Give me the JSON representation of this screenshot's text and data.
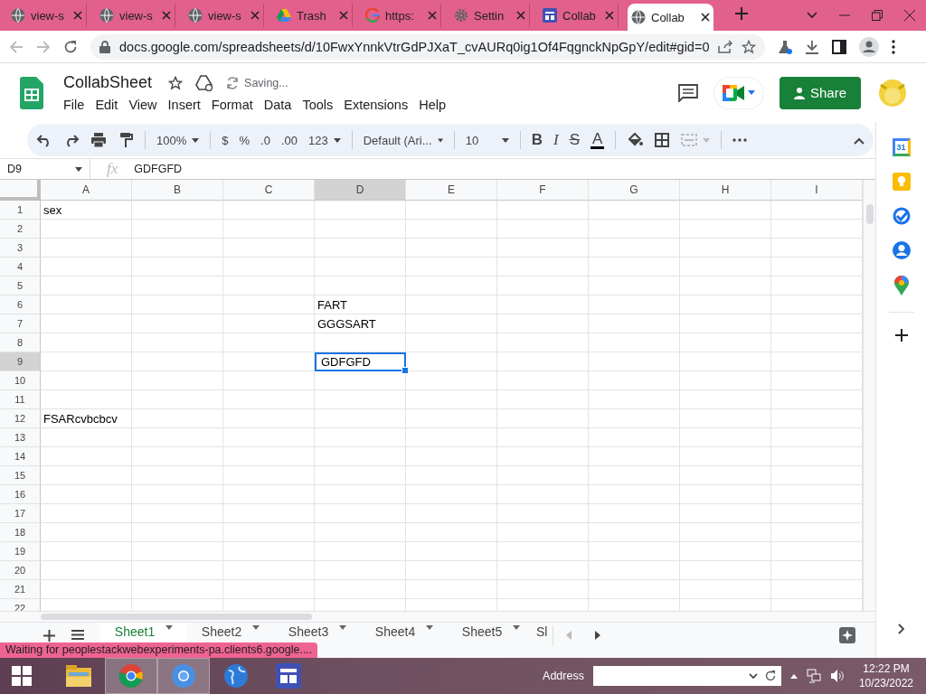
{
  "browser": {
    "tabs": [
      {
        "title": "view-s",
        "kind": "globe",
        "selected": false
      },
      {
        "title": "view-s",
        "kind": "globe",
        "selected": false
      },
      {
        "title": "view-s",
        "kind": "globe",
        "selected": false
      },
      {
        "title": "Trash",
        "kind": "drive",
        "selected": false
      },
      {
        "title": "https:",
        "kind": "google",
        "selected": false
      },
      {
        "title": "Settin",
        "kind": "gear",
        "selected": false
      },
      {
        "title": "Collab",
        "kind": "sheets",
        "selected": false
      },
      {
        "title": "Collab",
        "kind": "globe",
        "selected": true
      }
    ],
    "url": "docs.google.com/spreadsheets/d/10FwxYnnkVtrGdPJXaT_cvAURq0ig1Of4FqgnckNpGpY/edit#gid=0"
  },
  "app": {
    "title": "CollabSheet",
    "status": "Saving...",
    "menus": [
      "File",
      "Edit",
      "View",
      "Insert",
      "Format",
      "Data",
      "Tools",
      "Extensions",
      "Help"
    ],
    "share": "Share"
  },
  "toolbar": {
    "zoom": "100%",
    "currency": "$",
    "percent": "%",
    "decrease_decimals": ".0",
    "increase_decimals": ".00",
    "number_format": "123",
    "font": "Default (Ari...",
    "font_size": "10",
    "bold": "B",
    "italic": "I",
    "strikethrough": "S",
    "text_color": "A"
  },
  "formula_bar": {
    "cell_ref": "D9",
    "function_label": "fx",
    "value": "GDFGFD"
  },
  "grid": {
    "columns": [
      {
        "label": "A",
        "selected": false
      },
      {
        "label": "B",
        "selected": false
      },
      {
        "label": "C",
        "selected": false
      },
      {
        "label": "D",
        "selected": true
      },
      {
        "label": "E",
        "selected": false
      },
      {
        "label": "F",
        "selected": false
      },
      {
        "label": "G",
        "selected": false
      },
      {
        "label": "H",
        "selected": false
      },
      {
        "label": "I",
        "selected": false
      }
    ],
    "rows": [
      {
        "number": "1",
        "selected": false,
        "cells": {
          "A": {
            "text": "sex",
            "active": false
          }
        }
      },
      {
        "number": "2",
        "selected": false
      },
      {
        "number": "3",
        "selected": false
      },
      {
        "number": "4",
        "selected": false
      },
      {
        "number": "5",
        "selected": false
      },
      {
        "number": "6",
        "selected": false,
        "cells": {
          "D": {
            "text": "FART",
            "active": false
          }
        }
      },
      {
        "number": "7",
        "selected": false,
        "cells": {
          "D": {
            "text": "GGGSART",
            "active": false
          }
        }
      },
      {
        "number": "8",
        "selected": false
      },
      {
        "number": "9",
        "selected": true,
        "cells": {
          "D": {
            "text": "GDFGFD",
            "active": true
          }
        }
      },
      {
        "number": "10",
        "selected": false
      },
      {
        "number": "11",
        "selected": false
      },
      {
        "number": "12",
        "selected": false,
        "cells": {
          "A": {
            "text": "FSARcvbcbcv",
            "active": false
          }
        }
      },
      {
        "number": "13",
        "selected": false
      },
      {
        "number": "14",
        "selected": false
      },
      {
        "number": "15",
        "selected": false
      },
      {
        "number": "16",
        "selected": false
      },
      {
        "number": "17",
        "selected": false
      },
      {
        "number": "18",
        "selected": false
      },
      {
        "number": "19",
        "selected": false
      },
      {
        "number": "20",
        "selected": false
      },
      {
        "number": "21",
        "selected": false
      },
      {
        "number": "22",
        "selected": false
      }
    ]
  },
  "sheet_tabs": [
    {
      "label": "Sheet1",
      "selected": true
    },
    {
      "label": "Sheet2",
      "selected": false
    },
    {
      "label": "Sheet3",
      "selected": false
    },
    {
      "label": "Sheet4",
      "selected": false
    },
    {
      "label": "Sheet5",
      "selected": false
    },
    {
      "label": "Sl",
      "selected": false
    }
  ],
  "side_panel": {
    "calendar_day": "31"
  },
  "status_tooltip": "Waiting for peoplestackwebexperiments-pa.clients6.google....",
  "taskbar": {
    "apps": [
      {
        "kind": "folder",
        "selected": false
      },
      {
        "kind": "chrome",
        "selected": true
      },
      {
        "kind": "chromium",
        "selected": true
      },
      {
        "kind": "globe",
        "selected": false
      },
      {
        "kind": "layout",
        "selected": false
      }
    ],
    "address_label": "Address",
    "time": "12:22 PM",
    "date": "10/23/2022"
  }
}
